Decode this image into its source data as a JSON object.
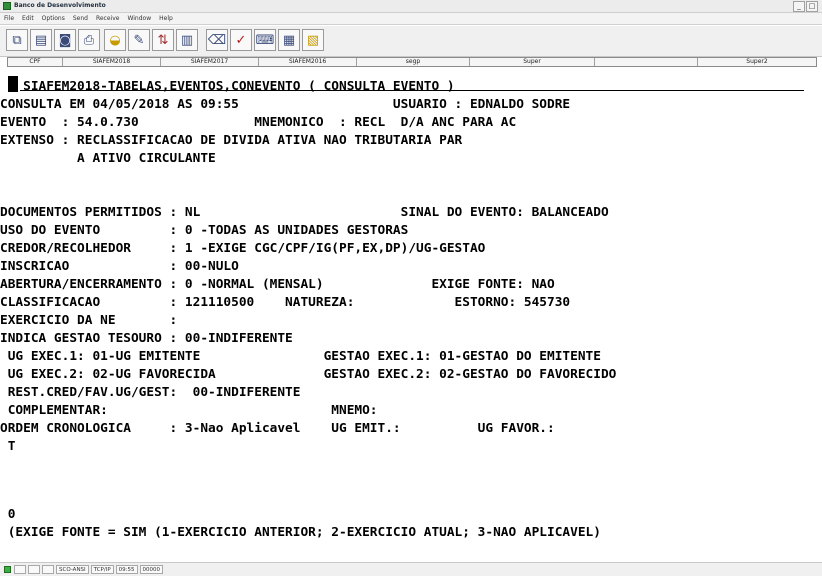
{
  "window": {
    "title": "Banco de Desenvolvimento",
    "controls": [
      "_",
      "□"
    ]
  },
  "menu": [
    "File",
    "Edit",
    "Options",
    "Send",
    "Receive",
    "Window",
    "Help"
  ],
  "toolbar_icons": [
    "copy-icon",
    "paste-icon",
    "camera-icon",
    "printer-icon",
    "transfer-icon",
    "edit-icon",
    "receive-icon",
    "columns-icon",
    "eraser-icon",
    "spellcheck-icon",
    "keyboard-icon",
    "calculator-icon",
    "chart-icon"
  ],
  "keys": [
    "CPF",
    "SIAFEM2018",
    "SIAFEM2017",
    "SIAFEM2016",
    "segp",
    "Super",
    "",
    "Super2"
  ],
  "screen_lines": [
    "   SIAFEM2018-TABELAS,EVENTOS,CONEVENTO ( CONSULTA EVENTO )",
    "CONSULTA EM 04/05/2018 AS 09:55                    USUARIO : EDNALDO SODRE",
    "EVENTO  : 54.0.730               MNEMONICO  : RECL  D/A ANC PARA AC",
    "EXTENSO : RECLASSIFICACAO DE DIVIDA ATIVA NAO TRIBUTARIA PAR",
    "          A ATIVO CIRCULANTE",
    "",
    "DOCUMENTOS PERMITIDOS : NL                          SINAL DO EVENTO: BALANCEADO",
    "USO DO EVENTO         : 0 -TODAS AS UNIDADES GESTORAS",
    "CREDOR/RECOLHEDOR     : 1 -EXIGE CGC/CPF/IG(PF,EX,DP)/UG-GESTAO",
    "INSCRICAO             : 00-NULO",
    "ABERTURA/ENCERRAMENTO : 0 -NORMAL (MENSAL)              EXIGE FONTE: NAO",
    "CLASSIFICACAO         : 121110500    NATUREZA:             ESTORNO: 545730",
    "EXERCICIO DA NE       :",
    "INDICA GESTAO TESOURO : 00-INDIFERENTE",
    " UG EXEC.1: 01-UG EMITENTE                GESTAO EXEC.1: 01-GESTAO DO EMITENTE",
    " UG EXEC.2: 02-UG FAVORECIDA              GESTAO EXEC.2: 02-GESTAO DO FAVORECIDO",
    " REST.CRED/FAV.UG/GEST:  00-INDIFERENTE",
    " COMPLEMENTAR:                             MNEMO:",
    "ORDEM CRONOLOGICA     : 3-Nao Aplicavel    UG EMIT.:          UG FAVOR.:",
    " T",
    "",
    " 0",
    " (EXIGE FONTE = SIM (1-EXERCICIO ANTERIOR; 2-EXERCICIO ATUAL; 3-NAO APLICAVEL)"
  ],
  "status": {
    "boxes": [
      "",
      "",
      "",
      "SCO-ANSI",
      "TCP/IP",
      "09:55",
      "00000"
    ],
    "connected_color": "#3cb043"
  }
}
